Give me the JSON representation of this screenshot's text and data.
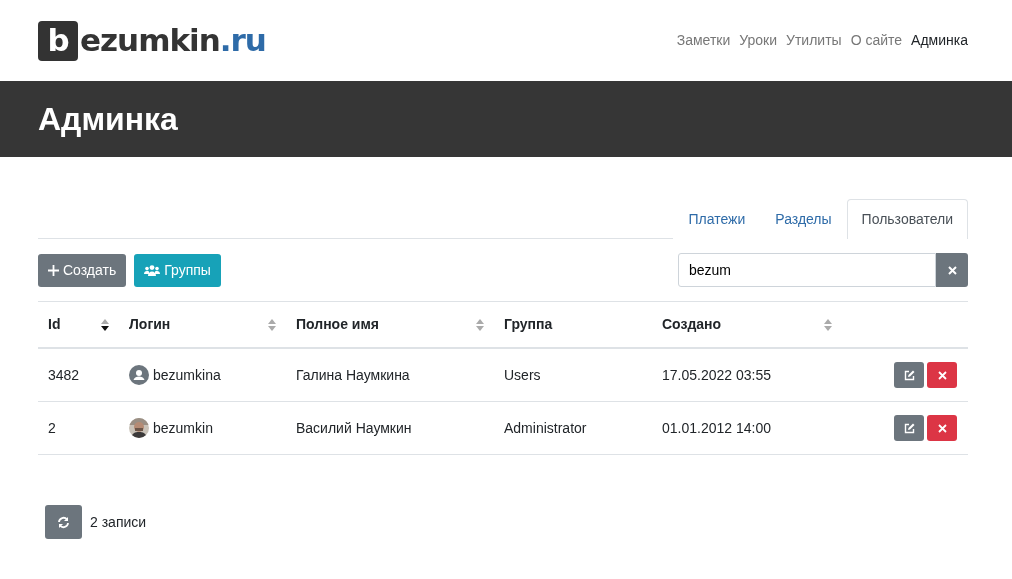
{
  "logo": {
    "mark": "b",
    "name": "ezumkin",
    "tld": ".ru"
  },
  "nav": [
    {
      "label": "Заметки",
      "selected": false
    },
    {
      "label": "Уроки",
      "selected": false
    },
    {
      "label": "Утилиты",
      "selected": false
    },
    {
      "label": "О сайте",
      "selected": false
    },
    {
      "label": "Админка",
      "selected": true
    }
  ],
  "page_title": "Админка",
  "tabs": [
    {
      "label": "Платежи",
      "selected": false
    },
    {
      "label": "Разделы",
      "selected": false
    },
    {
      "label": "Пользователи",
      "selected": true
    }
  ],
  "toolbar": {
    "buttons": [
      {
        "label": "Создать",
        "kind": "create"
      },
      {
        "label": "Группы",
        "kind": "groups"
      }
    ],
    "search": {
      "value": "bezum"
    }
  },
  "table": {
    "columns": [
      {
        "label": "Id",
        "kind": "descending"
      },
      {
        "label": "Логин",
        "kind": "sortable"
      },
      {
        "label": "Полное имя",
        "kind": "sortable"
      },
      {
        "label": "Группа",
        "kind": "plain"
      },
      {
        "label": "Создано",
        "kind": "sortable"
      }
    ],
    "rows": [
      {
        "id": "3482",
        "login": "bezumkina",
        "kind": "placeholder",
        "name": "Галина Наумкина",
        "group": "Users",
        "created": "17.05.2022 03:55"
      },
      {
        "id": "2",
        "login": "bezumkin",
        "name": "Василий Наумкин",
        "group": "Administrator",
        "created": "01.01.2012 14:00"
      }
    ]
  },
  "footer": {
    "count": "2 записи"
  }
}
